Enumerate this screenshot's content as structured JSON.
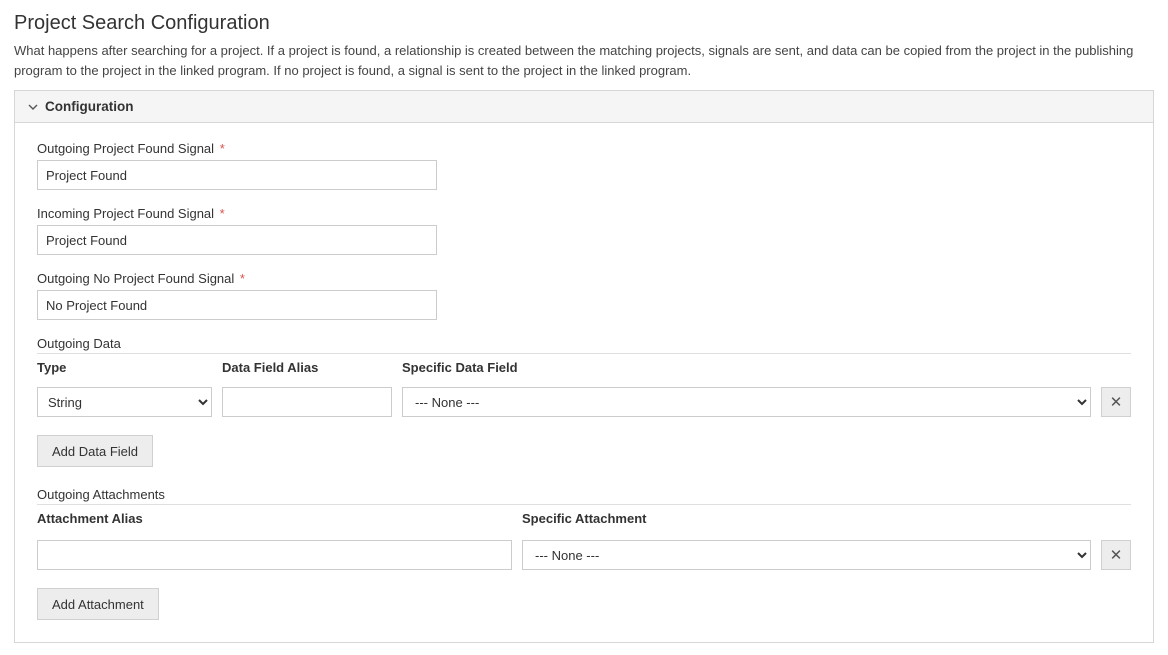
{
  "page": {
    "title": "Project Search Configuration",
    "description": "What happens after searching for a project. If a project is found, a relationship is created between the matching projects, signals are sent, and data can be copied from the project in the publishing program to the project in the linked program. If no project is found, a signal is sent to the project in the linked program."
  },
  "panel": {
    "title": "Configuration"
  },
  "fields": {
    "outgoing_found": {
      "label": "Outgoing Project Found Signal",
      "value": "Project Found"
    },
    "incoming_found": {
      "label": "Incoming Project Found Signal",
      "value": "Project Found"
    },
    "outgoing_not_found": {
      "label": "Outgoing No Project Found Signal",
      "value": "No Project Found"
    }
  },
  "outgoing_data": {
    "label": "Outgoing Data",
    "headers": {
      "type": "Type",
      "alias": "Data Field Alias",
      "specific": "Specific Data Field"
    },
    "rows": [
      {
        "type": "String",
        "alias": "",
        "specific": "--- None ---"
      }
    ],
    "add_button": "Add Data Field"
  },
  "outgoing_attachments": {
    "label": "Outgoing Attachments",
    "headers": {
      "alias": "Attachment Alias",
      "specific": "Specific Attachment"
    },
    "rows": [
      {
        "alias": "",
        "specific": "--- None ---"
      }
    ],
    "add_button": "Add Attachment"
  },
  "required_marker": "*"
}
